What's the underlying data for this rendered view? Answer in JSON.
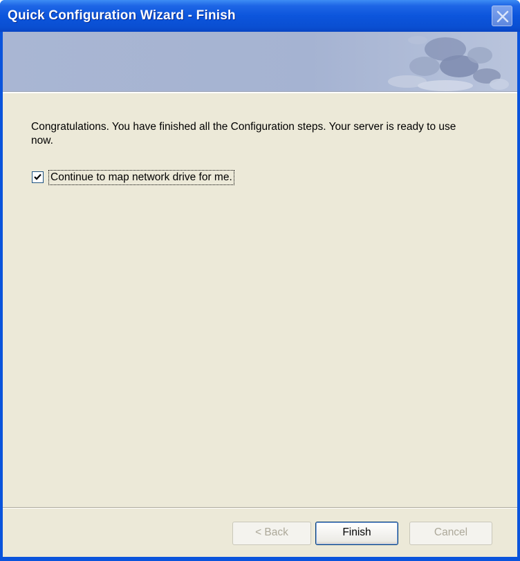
{
  "window": {
    "title": "Quick Configuration Wizard - Finish"
  },
  "icons": {
    "close": "close-icon",
    "check": "checkmark-icon",
    "banner": "bubbles-decoration"
  },
  "content": {
    "message": "Congratulations. You have finished all the Configuration steps.   Your server is ready to use now.",
    "checkbox_label": "Continue to map network drive for me.",
    "checkbox_checked": true
  },
  "buttons": {
    "back": "< Back",
    "finish": "Finish",
    "cancel": "Cancel"
  },
  "colors": {
    "titlebar": "#0a54dc",
    "dialog_bg": "#ece9d8",
    "banner": "#a9b6d3"
  }
}
